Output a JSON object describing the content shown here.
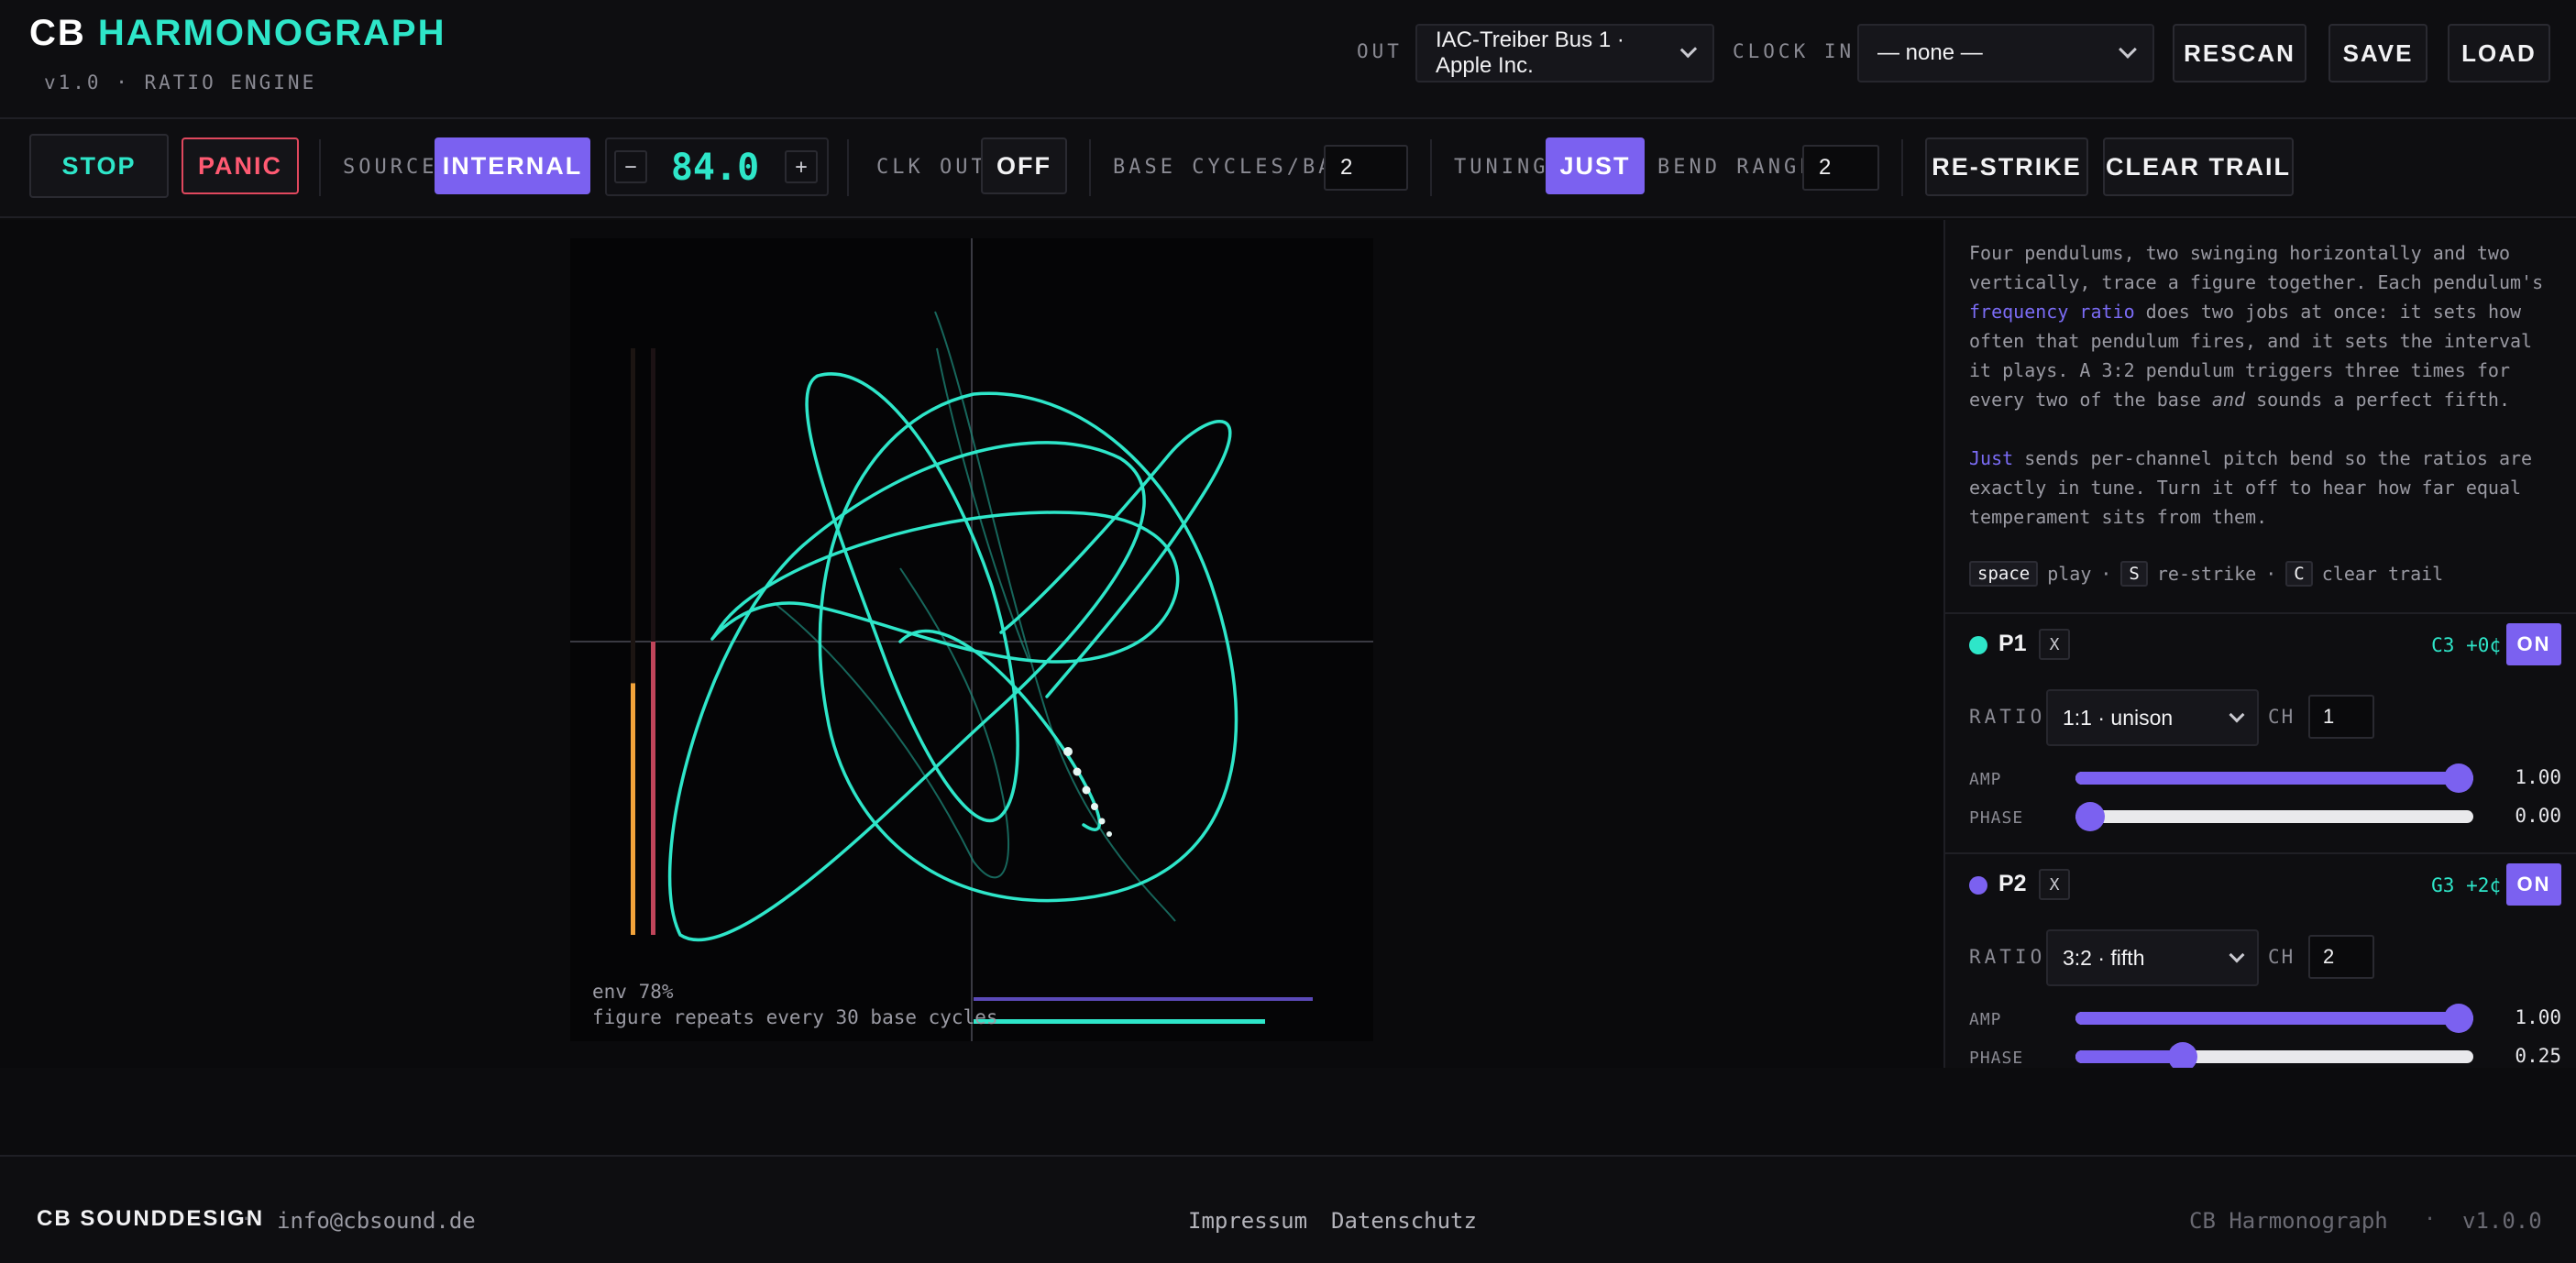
{
  "header": {
    "brand_prefix": "CB",
    "brand_name": "HARMONOGRAPH",
    "version_line": "v1.0 · RATIO ENGINE",
    "out_label": "OUT",
    "out_value": "IAC-Treiber Bus 1 · Apple Inc.",
    "clock_in_label": "CLOCK IN",
    "clock_in_value": "— none —",
    "rescan_label": "RESCAN",
    "save_label": "SAVE",
    "load_label": "LOAD"
  },
  "toolbar": {
    "stop_label": "STOP",
    "panic_label": "PANIC",
    "source_label": "SOURCE",
    "source_value": "INTERNAL",
    "tempo_minus": "−",
    "tempo_value": "84.0",
    "tempo_plus": "+",
    "clk_out_label": "CLK OUT",
    "clk_out_value": "OFF",
    "base_cycles_label": "BASE CYCLES/BAR",
    "base_cycles_value": "2",
    "tuning_label": "TUNING",
    "tuning_value": "JUST",
    "bend_range_label": "BEND RANGE",
    "bend_range_value": "2",
    "restrike_label": "RE-STRIKE",
    "clear_trail_label": "CLEAR TRAIL"
  },
  "stage": {
    "env_text": "env 78%",
    "envelope_level": 0.78,
    "cycle_text": "figure repeats every 30 base cycles"
  },
  "sidebar": {
    "desc_p1_a": "Four pendulums, two swinging horizontally and two vertically, trace a figure together. Each pendulum's ",
    "desc_p1_hl": "frequency ratio",
    "desc_p1_b": " does two jobs at once: it sets how often that pendulum fires, and it sets the interval it plays. A 3:2 pendulum triggers three times for every two of the base ",
    "desc_p1_em": "and",
    "desc_p1_c": " sounds a perfect fifth.",
    "desc_p2_hl": "Just",
    "desc_p2_rest": " sends per-channel pitch bend so the ratios are exactly in tune. Turn it off to hear how far equal temperament sits from them.",
    "shortcuts": {
      "k1": "space",
      "t1": "play",
      "sep": "·",
      "k2": "S",
      "t2": "re-strike",
      "k3": "C",
      "t3": "clear trail"
    },
    "pendulums": [
      {
        "name": "P1",
        "color": "#2ee6c9",
        "remove": "X",
        "note": "C3 +0¢",
        "state": "ON",
        "ratio_label": "RATIO",
        "ratio": "1:1 · unison",
        "ch_label": "CH",
        "ch": "1",
        "amp_label": "AMP",
        "amp": "1.00",
        "amp_level": 1.0,
        "phase_label": "PHASE",
        "phase": "0.00",
        "phase_level": 0.0
      },
      {
        "name": "P2",
        "color": "#7b61f0",
        "remove": "X",
        "note": "G3 +2¢",
        "state": "ON",
        "ratio_label": "RATIO",
        "ratio": "3:2 · fifth",
        "ch_label": "CH",
        "ch": "2",
        "amp_label": "AMP",
        "amp": "1.00",
        "amp_level": 1.0,
        "phase_label": "PHASE",
        "phase": "0.25",
        "phase_level": 0.25
      }
    ]
  },
  "footer": {
    "brand": "CB SOUNDDESIGN",
    "sep": "·",
    "email": "info@cbsound.de",
    "impressum": "Impressum",
    "datenschutz": "Datenschutz",
    "app_name": "CB Harmonograph",
    "version": "v1.0.0"
  },
  "colors": {
    "accent_teal": "#2ee6c9",
    "accent_purple": "#7b61f0",
    "panic_red": "#e0485e",
    "env_orange": "#f2a33a"
  }
}
